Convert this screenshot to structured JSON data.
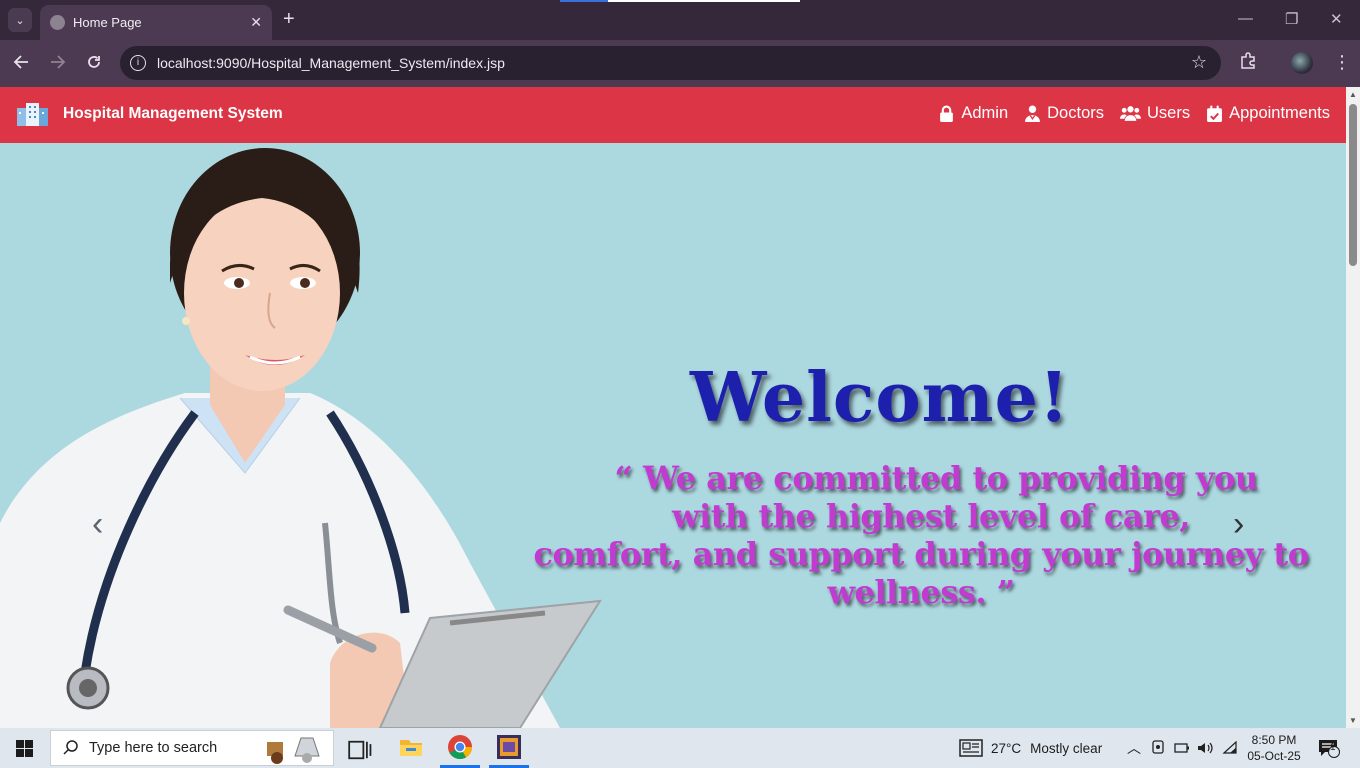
{
  "browser": {
    "tab_title": "Home Page",
    "url": "localhost:9090/Hospital_Management_System/index.jsp",
    "tab_close": "✕",
    "new_tab": "+",
    "minimize": "—",
    "restore": "❐",
    "close": "✕"
  },
  "navbar": {
    "brand": "Hospital Management System",
    "links": [
      {
        "label": "Admin",
        "icon": "lock-icon"
      },
      {
        "label": "Doctors",
        "icon": "doctor-icon"
      },
      {
        "label": "Users",
        "icon": "users-icon"
      },
      {
        "label": "Appointments",
        "icon": "calendar-check-icon"
      }
    ],
    "color": "#dc3545"
  },
  "hero": {
    "welcome": "Welcome!",
    "quote_lines": [
      "“ We are committed to providing you",
      "with the highest level of care,",
      "comfort, and support during your journey to",
      "wellness. ”"
    ],
    "background": "#acd8e0",
    "welcome_color": "#1d1fad",
    "quote_color": "#c13bd0",
    "prev": "‹",
    "next": "›"
  },
  "taskbar": {
    "search_placeholder": "Type here to search",
    "weather_temp": "27°C",
    "weather_text": "Mostly clear",
    "time": "8:50 PM",
    "date": "05-Oct-25",
    "notifications": "1"
  }
}
